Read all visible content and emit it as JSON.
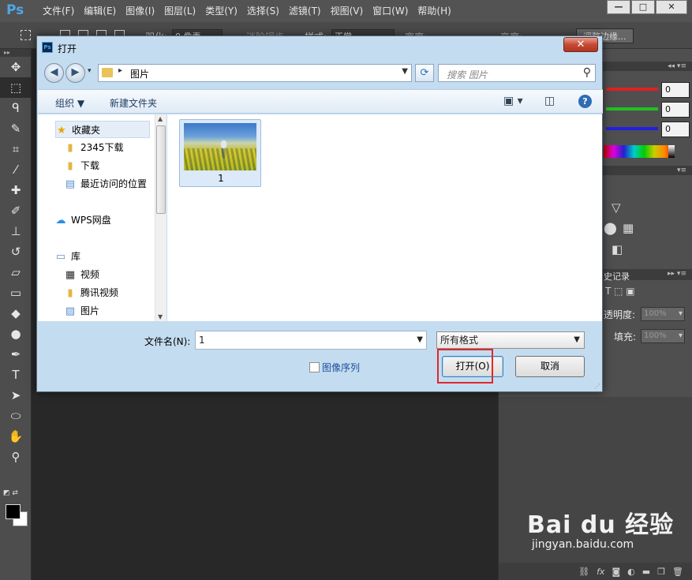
{
  "app": {
    "logo": "Ps",
    "menu": [
      "文件(F)",
      "编辑(E)",
      "图像(I)",
      "图层(L)",
      "类型(Y)",
      "选择(S)",
      "滤镜(T)",
      "视图(V)",
      "窗口(W)",
      "帮助(H)"
    ],
    "window_controls": {
      "minimize": "—",
      "maximize": "□",
      "close": "✕"
    }
  },
  "options_bar": {
    "feather_label": "羽化:",
    "feather_value": "0 像素",
    "antialias_label": "消除锯齿",
    "style_label": "样式:",
    "style_value": "正常",
    "width_label": "宽度:",
    "height_label": "高度:",
    "refine_button": "调整边缘..."
  },
  "tools": [
    {
      "name": "move-tool",
      "glyph": "✥"
    },
    {
      "name": "marquee-tool",
      "glyph": "⬚"
    },
    {
      "name": "lasso-tool",
      "glyph": "ᑫ"
    },
    {
      "name": "quick-select-tool",
      "glyph": "✎"
    },
    {
      "name": "crop-tool",
      "glyph": "⌗"
    },
    {
      "name": "eyedropper-tool",
      "glyph": "⁄"
    },
    {
      "name": "healing-tool",
      "glyph": "✚"
    },
    {
      "name": "brush-tool",
      "glyph": "✐"
    },
    {
      "name": "stamp-tool",
      "glyph": "⊥"
    },
    {
      "name": "history-brush-tool",
      "glyph": "↺"
    },
    {
      "name": "eraser-tool",
      "glyph": "▱"
    },
    {
      "name": "gradient-tool",
      "glyph": "▭"
    },
    {
      "name": "blur-tool",
      "glyph": "◆"
    },
    {
      "name": "dodge-tool",
      "glyph": "●"
    },
    {
      "name": "pen-tool",
      "glyph": "✒"
    },
    {
      "name": "type-tool",
      "glyph": "T"
    },
    {
      "name": "path-select-tool",
      "glyph": "➤"
    },
    {
      "name": "ellipse-tool",
      "glyph": "⬭"
    },
    {
      "name": "hand-tool",
      "glyph": "✋"
    },
    {
      "name": "zoom-tool",
      "glyph": "⚲"
    }
  ],
  "panels": {
    "channels": [
      {
        "color": "#e02020",
        "value": "0"
      },
      {
        "color": "#20c020",
        "value": "0"
      },
      {
        "color": "#2020e0",
        "value": "0"
      }
    ],
    "history_tab": "史记录",
    "opacity_label": "透明度:",
    "opacity_value": "100%",
    "fill_label": "填充:",
    "fill_value": "100%"
  },
  "dialog": {
    "title": "打开",
    "close_glyph": "✕",
    "address": {
      "current_folder": "图片"
    },
    "search": {
      "placeholder": "搜索 图片"
    },
    "commands": {
      "organize": "组织 ▼",
      "new_folder": "新建文件夹"
    },
    "nav": {
      "favorites": "收藏夹",
      "fav_items": [
        "2345下载",
        "下载",
        "最近访问的位置"
      ],
      "wps": "WPS网盘",
      "libraries": "库",
      "lib_items": [
        "视频",
        "腾讯视频",
        "图片"
      ]
    },
    "files": [
      {
        "label": "1"
      }
    ],
    "filename_label": "文件名(N):",
    "filename_value": "1",
    "filetype_value": "所有格式",
    "image_sequence_label": "图像序列",
    "open_button": "打开(O)",
    "cancel_button": "取消"
  },
  "watermark": {
    "logo": "Bai du 经验",
    "url": "jingyan.baidu.com"
  }
}
